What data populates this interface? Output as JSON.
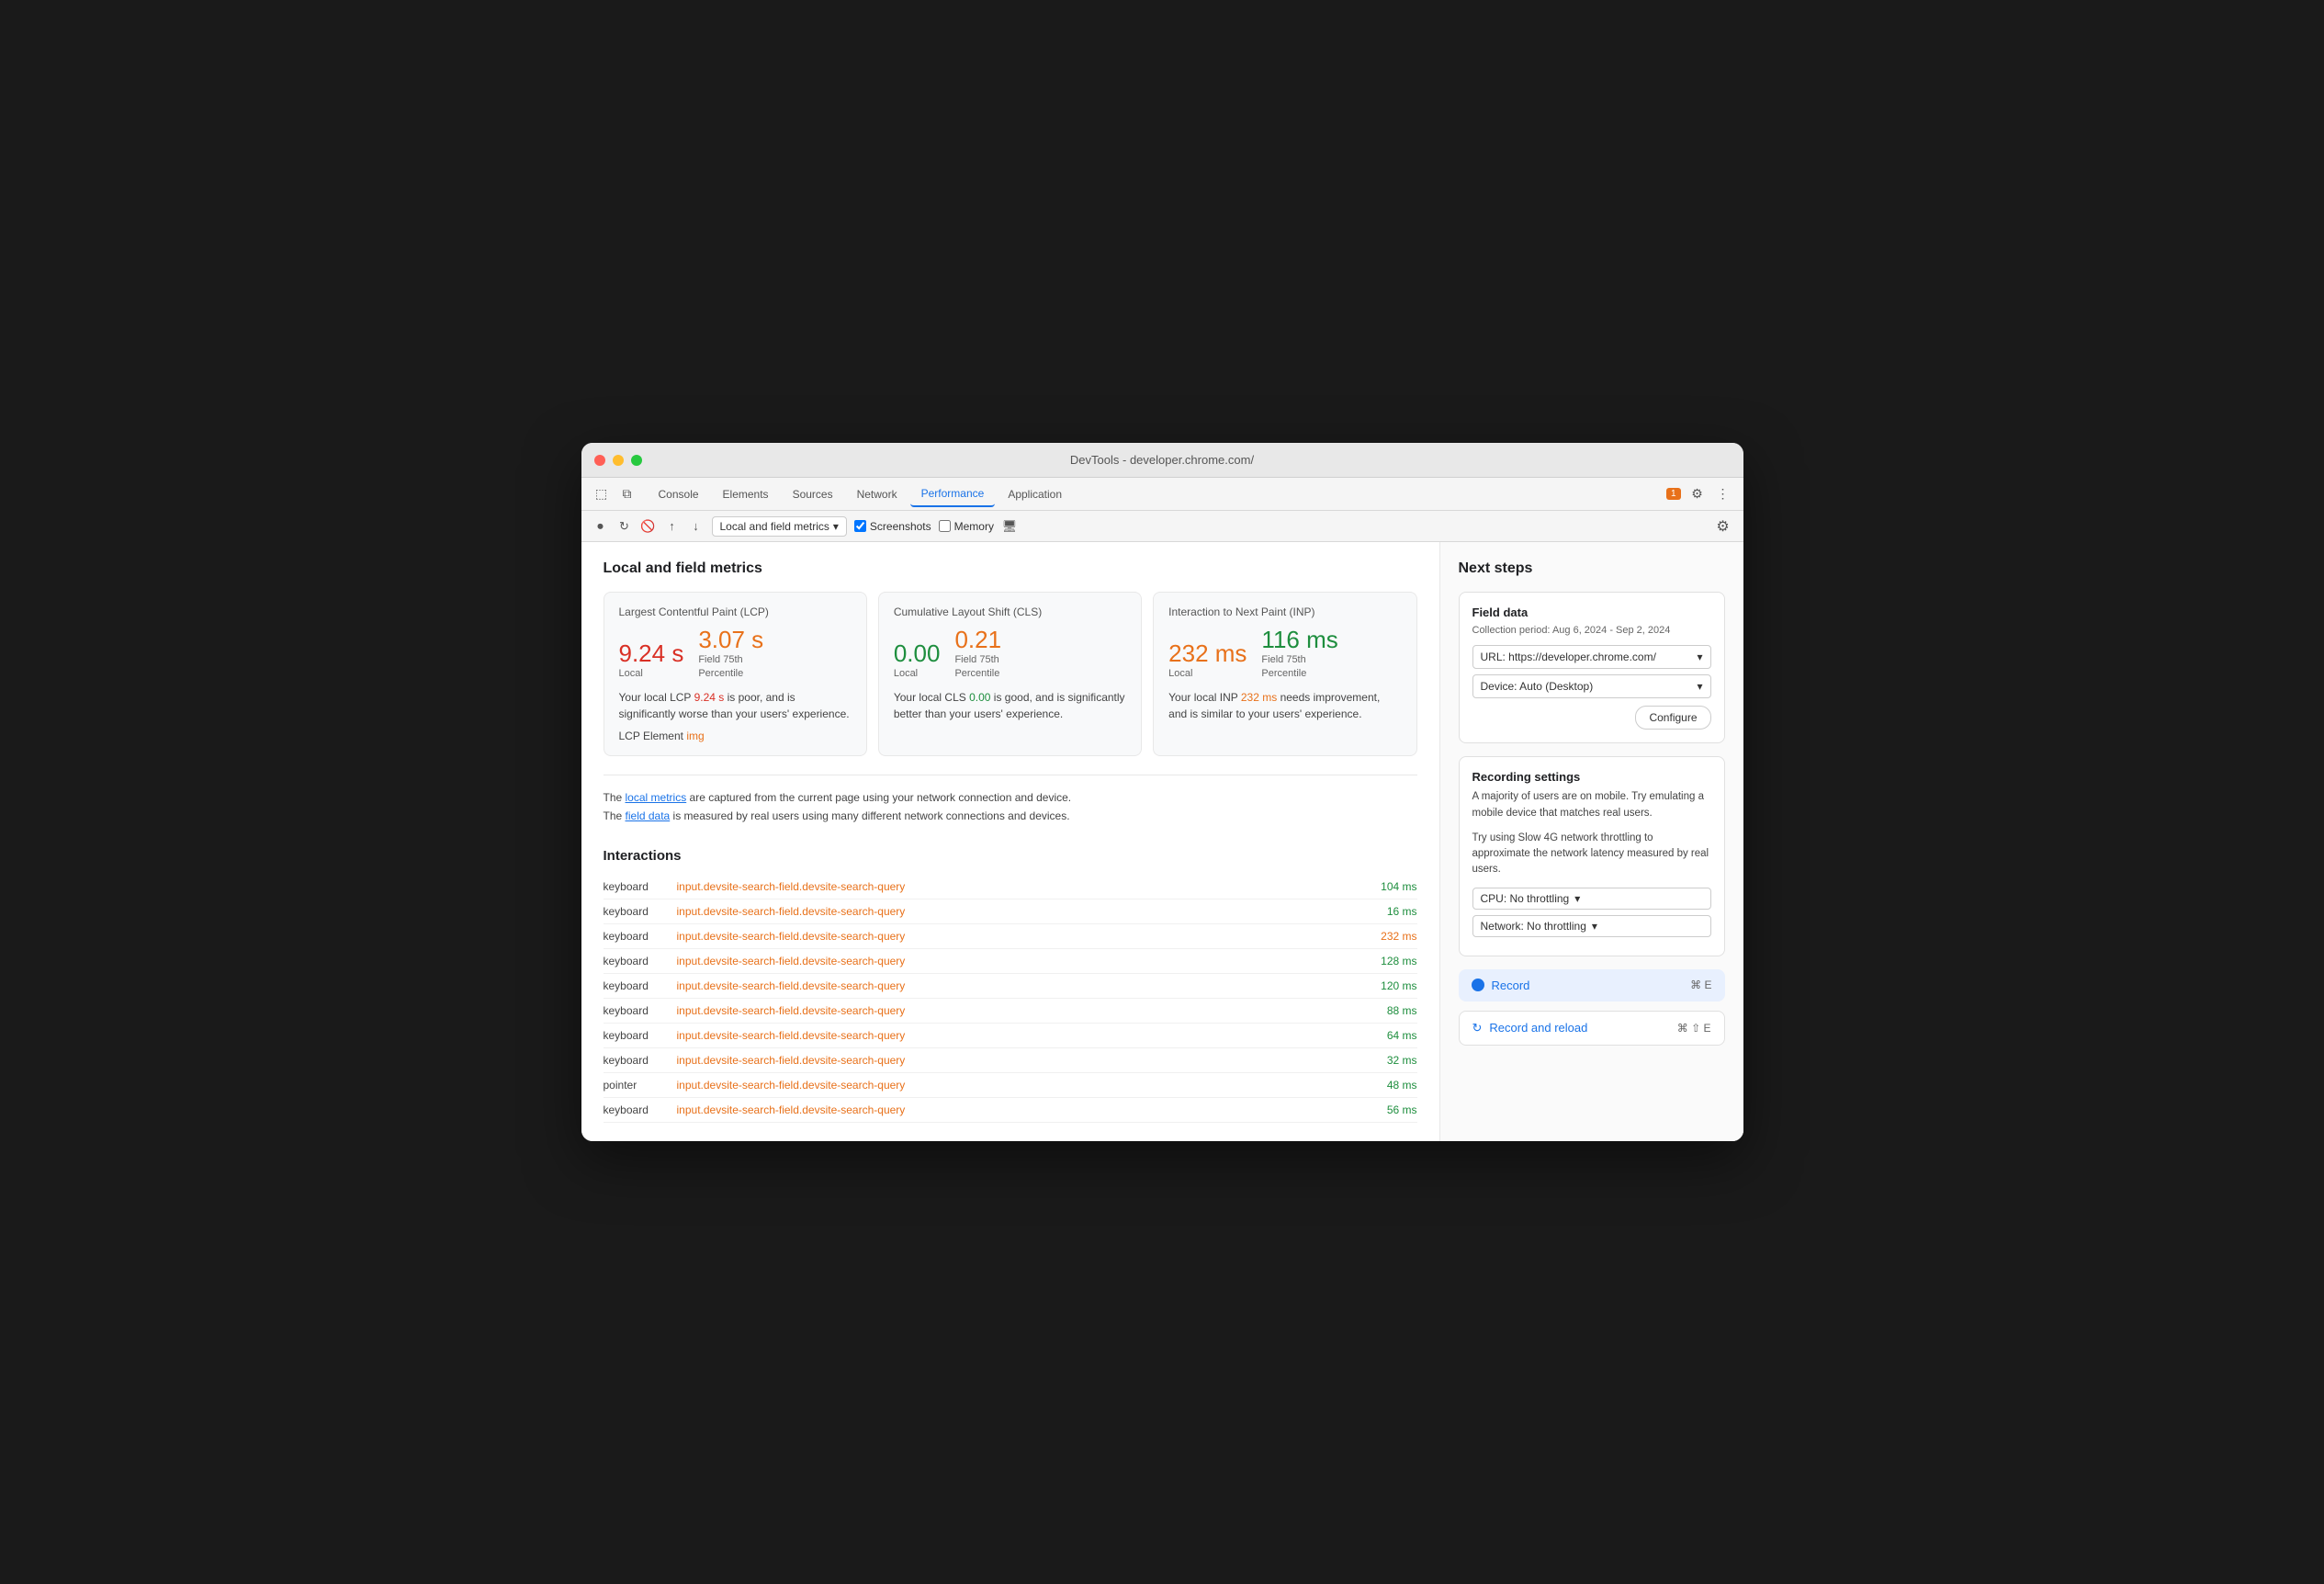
{
  "window": {
    "title": "DevTools - developer.chrome.com/"
  },
  "tabs": [
    {
      "label": "Console",
      "active": false
    },
    {
      "label": "Elements",
      "active": false
    },
    {
      "label": "Sources",
      "active": false
    },
    {
      "label": "Network",
      "active": false
    },
    {
      "label": "Performance",
      "active": true
    },
    {
      "label": "Application",
      "active": false
    }
  ],
  "toolbar": {
    "badge": "1",
    "screenshots_label": "Screenshots",
    "memory_label": "Memory",
    "dropdown_label": "Local and field metrics"
  },
  "main_section_title": "Local and field metrics",
  "metrics": [
    {
      "id": "lcp",
      "title": "Largest Contentful Paint (LCP)",
      "local_value": "9.24 s",
      "local_label": "Local",
      "field_value": "3.07 s",
      "field_label": "Field 75th\nPercentile",
      "local_color": "red",
      "field_color": "orange",
      "description": "Your local LCP 9.24 s is poor, and is significantly worse than your users' experience.",
      "highlight_local": "9.24 s",
      "element_label": "LCP Element",
      "element_value": "img"
    },
    {
      "id": "cls",
      "title": "Cumulative Layout Shift (CLS)",
      "local_value": "0.00",
      "local_label": "Local",
      "field_value": "0.21",
      "field_label": "Field 75th\nPercentile",
      "local_color": "green",
      "field_color": "orange",
      "description": "Your local CLS 0.00 is good, and is significantly better than your users' experience.",
      "highlight_local": "0.00"
    },
    {
      "id": "inp",
      "title": "Interaction to Next Paint (INP)",
      "local_value": "232 ms",
      "local_label": "Local",
      "field_value": "116 ms",
      "field_label": "Field 75th\nPercentile",
      "local_color": "orange",
      "field_color": "green",
      "description": "Your local INP 232 ms needs improvement, and is similar to your users' experience.",
      "highlight_local": "232 ms"
    }
  ],
  "footnote": {
    "line1_before": "The ",
    "line1_link": "local metrics",
    "line1_after": " are captured from the current page using your network connection and device.",
    "line2_before": "The ",
    "line2_link": "field data",
    "line2_after": " is measured by real users using many different network connections and devices."
  },
  "interactions_title": "Interactions",
  "interactions": [
    {
      "type": "keyboard",
      "selector": "input.devsite-search-field.devsite-search-query",
      "time": "104 ms",
      "color": "green"
    },
    {
      "type": "keyboard",
      "selector": "input.devsite-search-field.devsite-search-query",
      "time": "16 ms",
      "color": "green"
    },
    {
      "type": "keyboard",
      "selector": "input.devsite-search-field.devsite-search-query",
      "time": "232 ms",
      "color": "orange"
    },
    {
      "type": "keyboard",
      "selector": "input.devsite-search-field.devsite-search-query",
      "time": "128 ms",
      "color": "green"
    },
    {
      "type": "keyboard",
      "selector": "input.devsite-search-field.devsite-search-query",
      "time": "120 ms",
      "color": "green"
    },
    {
      "type": "keyboard",
      "selector": "input.devsite-search-field.devsite-search-query",
      "time": "88 ms",
      "color": "green"
    },
    {
      "type": "keyboard",
      "selector": "input.devsite-search-field.devsite-search-query",
      "time": "64 ms",
      "color": "green"
    },
    {
      "type": "keyboard",
      "selector": "input.devsite-search-field.devsite-search-query",
      "time": "32 ms",
      "color": "green"
    },
    {
      "type": "pointer",
      "selector": "input.devsite-search-field.devsite-search-query",
      "time": "48 ms",
      "color": "green"
    },
    {
      "type": "keyboard",
      "selector": "input.devsite-search-field.devsite-search-query",
      "time": "56 ms",
      "color": "green"
    }
  ],
  "right_panel": {
    "title": "Next steps",
    "field_data": {
      "title": "Field data",
      "subtitle": "Collection period: Aug 6, 2024 - Sep 2, 2024",
      "url_label": "URL: https://developer.chrome.com/",
      "device_label": "Device: Auto (Desktop)",
      "configure_btn": "Configure"
    },
    "recording_settings": {
      "title": "Recording settings",
      "desc1": "A majority of users are on mobile. Try emulating a mobile device that matches real users.",
      "desc2": "Try using Slow 4G network throttling to approximate the network latency measured by real users.",
      "cpu_label": "CPU: No throttling",
      "network_label": "Network: No throttling"
    },
    "record_btn": {
      "label": "Record",
      "shortcut": "⌘ E"
    },
    "record_reload_btn": {
      "label": "Record and reload",
      "shortcut": "⌘ ⇧ E"
    }
  }
}
